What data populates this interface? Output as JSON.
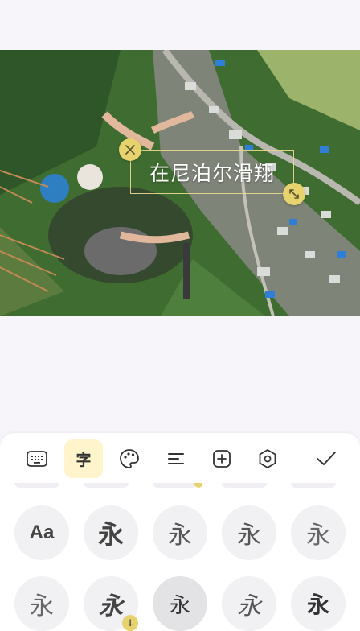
{
  "overlay_text": {
    "caption": "在尼泊尔滑翔"
  },
  "toolbar": {
    "items": [
      {
        "name": "keyboard",
        "icon": "keyboard-icon"
      },
      {
        "name": "font",
        "icon": "font-icon",
        "label": "字",
        "active": true
      },
      {
        "name": "color",
        "icon": "palette-icon"
      },
      {
        "name": "align",
        "icon": "align-icon"
      },
      {
        "name": "add",
        "icon": "plus-box-icon"
      },
      {
        "name": "style",
        "icon": "hexagon-icon"
      },
      {
        "name": "confirm",
        "icon": "check-icon"
      }
    ]
  },
  "fonts": {
    "row1": [
      "Aa",
      "永",
      "永",
      "永",
      "永"
    ],
    "row2": [
      "永",
      "永",
      "永",
      "永",
      "永"
    ]
  },
  "colors": {
    "accent": "#e6d36d",
    "active_tab_bg": "#fff4cc"
  }
}
